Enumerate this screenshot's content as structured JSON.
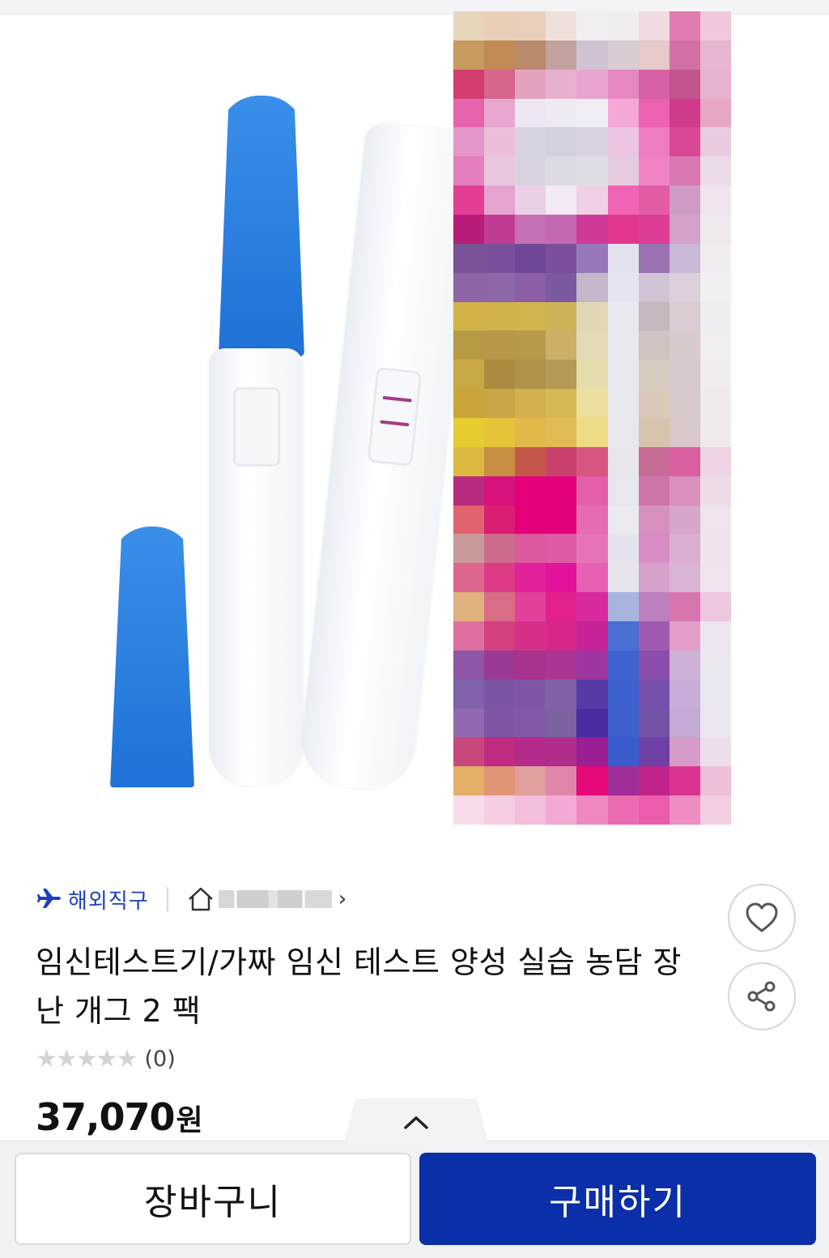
{
  "product": {
    "badge_label": "해외직구",
    "title": "임신테스트기/가짜 임신 테스트 양성 실습 농담 장난 개그 2 팩",
    "rating_stars": 0,
    "review_count": "(0)",
    "price_value": "37,070",
    "price_unit": "원"
  },
  "actions": {
    "cart_label": "장바구니",
    "buy_label": "구매하기"
  },
  "icons": {
    "badge": "airplane-icon",
    "store": "home-icon",
    "store_chevron": "chevron-right-icon",
    "wishlist": "heart-icon",
    "share": "share-icon",
    "expand": "chevron-up-icon"
  },
  "colors": {
    "accent": "#0a2fa8",
    "badge_text": "#1d3fbf",
    "cap_blue": "#2e83e0"
  },
  "mosaic": [
    "#e8d6bc",
    "#e9cfb8",
    "#e8d0bd",
    "#efe1da",
    "#f1eef2",
    "#f1ecf0",
    "#f0dbe3",
    "#e07cb0",
    "#efc8dd",
    "#c99a5e",
    "#c08a55",
    "#b98a6b",
    "#c2a3a0",
    "#cfc3d3",
    "#d8cbd4",
    "#e7c9c8",
    "#d070a4",
    "#e8b6d0",
    "#d33d6d",
    "#d6658a",
    "#e3a3bf",
    "#e8b0d0",
    "#e8a4cf",
    "#e587c0",
    "#d860a4",
    "#c2558e",
    "#e7b3cf",
    "#e664ab",
    "#e8a7d0",
    "#eee6f2",
    "#eeeaf3",
    "#f1eef6",
    "#f5a7d5",
    "#ea62b0",
    "#cf3a8a",
    "#e8a6c5",
    "#e596c8",
    "#ecbedc",
    "#d9d3df",
    "#d6cfe0",
    "#dad1df",
    "#ebc5e1",
    "#ee7cc0",
    "#d94797",
    "#e9cbe0",
    "#e37fbd",
    "#e9c6df",
    "#d8d4df",
    "#dedae4",
    "#e0dce6",
    "#e6cbe0",
    "#f083c4",
    "#d978b0",
    "#ecdbe9",
    "#e23f94",
    "#e4a4cf",
    "#ead0e6",
    "#f1eaf5",
    "#f0d0e6",
    "#ef65b3",
    "#e25ca4",
    "#d09bc5",
    "#f0e4ee",
    "#b81d7a",
    "#c03c94",
    "#c570b4",
    "#c468b4",
    "#cf3a98",
    "#e2378f",
    "#dd3d94",
    "#d4a1c8",
    "#efe8ef",
    "#7a5296",
    "#7a4f9c",
    "#6f4799",
    "#7b4f9c",
    "#9678b8",
    "#e5e2ef",
    "#9b72b1",
    "#cab8d6",
    "#f1ebf2",
    "#8c66a5",
    "#8c68a8",
    "#8b5ea6",
    "#7b5aa0",
    "#c5b6cb",
    "#e6e4ee",
    "#d1c4d6",
    "#dbd0dc",
    "#f2eef2",
    "#d3b247",
    "#d2b34a",
    "#d1b44c",
    "#cfb257",
    "#e1d7b4",
    "#e8e8ef",
    "#c4b7bd",
    "#d9ccd4",
    "#f1ecf0",
    "#b89a44",
    "#b8964a",
    "#b9994a",
    "#cbb065",
    "#e4dab7",
    "#e9e9ef",
    "#d0c4c0",
    "#d8cbcd",
    "#f1eef0",
    "#c8a844",
    "#ad8a40",
    "#b09248",
    "#b49957",
    "#e5ddad",
    "#e8e7ee",
    "#d7cbbf",
    "#d6c8cd",
    "#f0ecef",
    "#caa53a",
    "#c9a547",
    "#d2b04c",
    "#d7b855",
    "#ecdf9f",
    "#e8e8ee",
    "#d8c9ba",
    "#d7c8cb",
    "#f0eaee",
    "#e6cc2f",
    "#e5c43a",
    "#e1b94b",
    "#e1bb53",
    "#eddb86",
    "#e8e8ee",
    "#d8c4ad",
    "#dac7ca",
    "#efe8ee",
    "#deb941",
    "#c88e43",
    "#c4594b",
    "#c9416a",
    "#d6567f",
    "#e8e5ec",
    "#c76b97",
    "#da5fa0",
    "#eed4e4",
    "#b82c7d",
    "#d8127c",
    "#e4007a",
    "#e4007d",
    "#e35fa7",
    "#e8e6ee",
    "#cd75a8",
    "#d990bd",
    "#eddbe8",
    "#e0636f",
    "#da1f73",
    "#e4007b",
    "#e3007d",
    "#e66bb1",
    "#eaeaf0",
    "#d691c1",
    "#d7a6c8",
    "#efe4ee",
    "#c99a99",
    "#cc6c8c",
    "#dc59a0",
    "#dc5ba4",
    "#e774b8",
    "#e5e4ee",
    "#d98cc4",
    "#d9aed0",
    "#efe2ed",
    "#dd6590",
    "#dd3a86",
    "#e2219a",
    "#e3129a",
    "#e560b2",
    "#e6e5ee",
    "#d6a2cb",
    "#dab4d4",
    "#efe3ee",
    "#dfb27f",
    "#d96d86",
    "#e2409b",
    "#e3228f",
    "#d92b9e",
    "#a8b4e0",
    "#bd81be",
    "#d875ae",
    "#edc6df",
    "#e06fa0",
    "#d4407e",
    "#d6308b",
    "#d8278a",
    "#c52397",
    "#4a6fd4",
    "#9f5bb0",
    "#e29ec8",
    "#ece5f0",
    "#8f55a7",
    "#9a3a94",
    "#a7338f",
    "#a93692",
    "#9e36a1",
    "#3f63cf",
    "#8b4eac",
    "#cdb1d7",
    "#ece6ef",
    "#7f62a9",
    "#7b55a4",
    "#7f57a6",
    "#8260a6",
    "#583aa6",
    "#3e61d0",
    "#7650ab",
    "#c8aed6",
    "#ebe5ef",
    "#9269b0",
    "#7f56a4",
    "#8159a6",
    "#7c61a1",
    "#4c2ba1",
    "#3e61cf",
    "#7353a6",
    "#c3abd4",
    "#ebe5ee",
    "#c9497f",
    "#bf2c82",
    "#b32a8a",
    "#b02d8e",
    "#9b1e95",
    "#3a5bcb",
    "#6e3fa4",
    "#d69bc6",
    "#ede0ec",
    "#e4b067",
    "#e19577",
    "#e0a09e",
    "#e186ab",
    "#e6097a",
    "#a02e9a",
    "#c0248a",
    "#da3290",
    "#eebfd9",
    "#f8dce9",
    "#f6cde3",
    "#f3bddc",
    "#f2a9d3",
    "#ef88c0",
    "#ec6bb1",
    "#ea5dac",
    "#ef8cc2",
    "#f3cde2"
  ]
}
